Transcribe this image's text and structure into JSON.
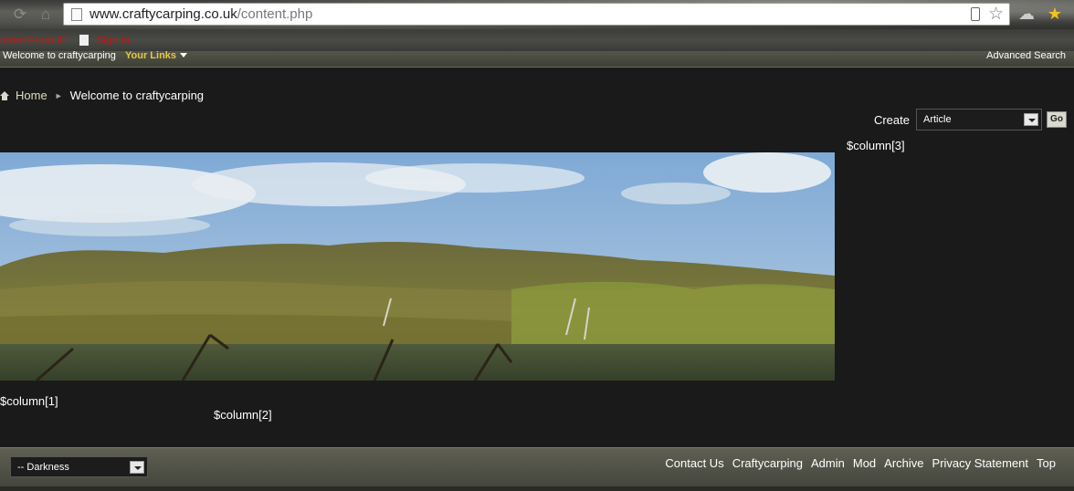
{
  "browser": {
    "url_domain": "www.craftycarping.co.uk",
    "url_path": "/content.php",
    "bookmarks": [
      "orted From IE",
      "Sign in"
    ]
  },
  "site_bar": {
    "welcome": "Welcome to craftycarping",
    "your_links": "Your Links",
    "advanced_search": "Advanced Search"
  },
  "breadcrumb": {
    "home": "Home",
    "current": "Welcome to craftycarping"
  },
  "create": {
    "label": "Create",
    "selected": "Article",
    "go": "Go"
  },
  "columns": {
    "col1": "$column[1]",
    "col2": "$column[2]",
    "col3": "$column[3]"
  },
  "footer": {
    "style_selected": "-- Darkness",
    "links": [
      "Contact Us",
      "Craftycarping",
      "Admin",
      "Mod",
      "Archive",
      "Privacy Statement",
      "Top"
    ]
  },
  "colors": {
    "page_bg": "#1a1a1a",
    "link_gold": "#e6c84a",
    "bookmark_red": "#c0160f"
  }
}
